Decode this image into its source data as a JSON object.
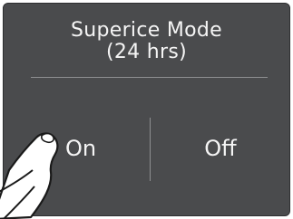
{
  "panel": {
    "title_line1": "Superice Mode",
    "title_line2": "(24 hrs)"
  },
  "options": {
    "on_label": "On",
    "off_label": "Off"
  },
  "overlay": {
    "icon": "hand-pointer-icon",
    "target": "on"
  },
  "colors": {
    "panel_bg": "#4a4b4d",
    "text": "#f5f5f5",
    "divider": "#8e8f91"
  }
}
